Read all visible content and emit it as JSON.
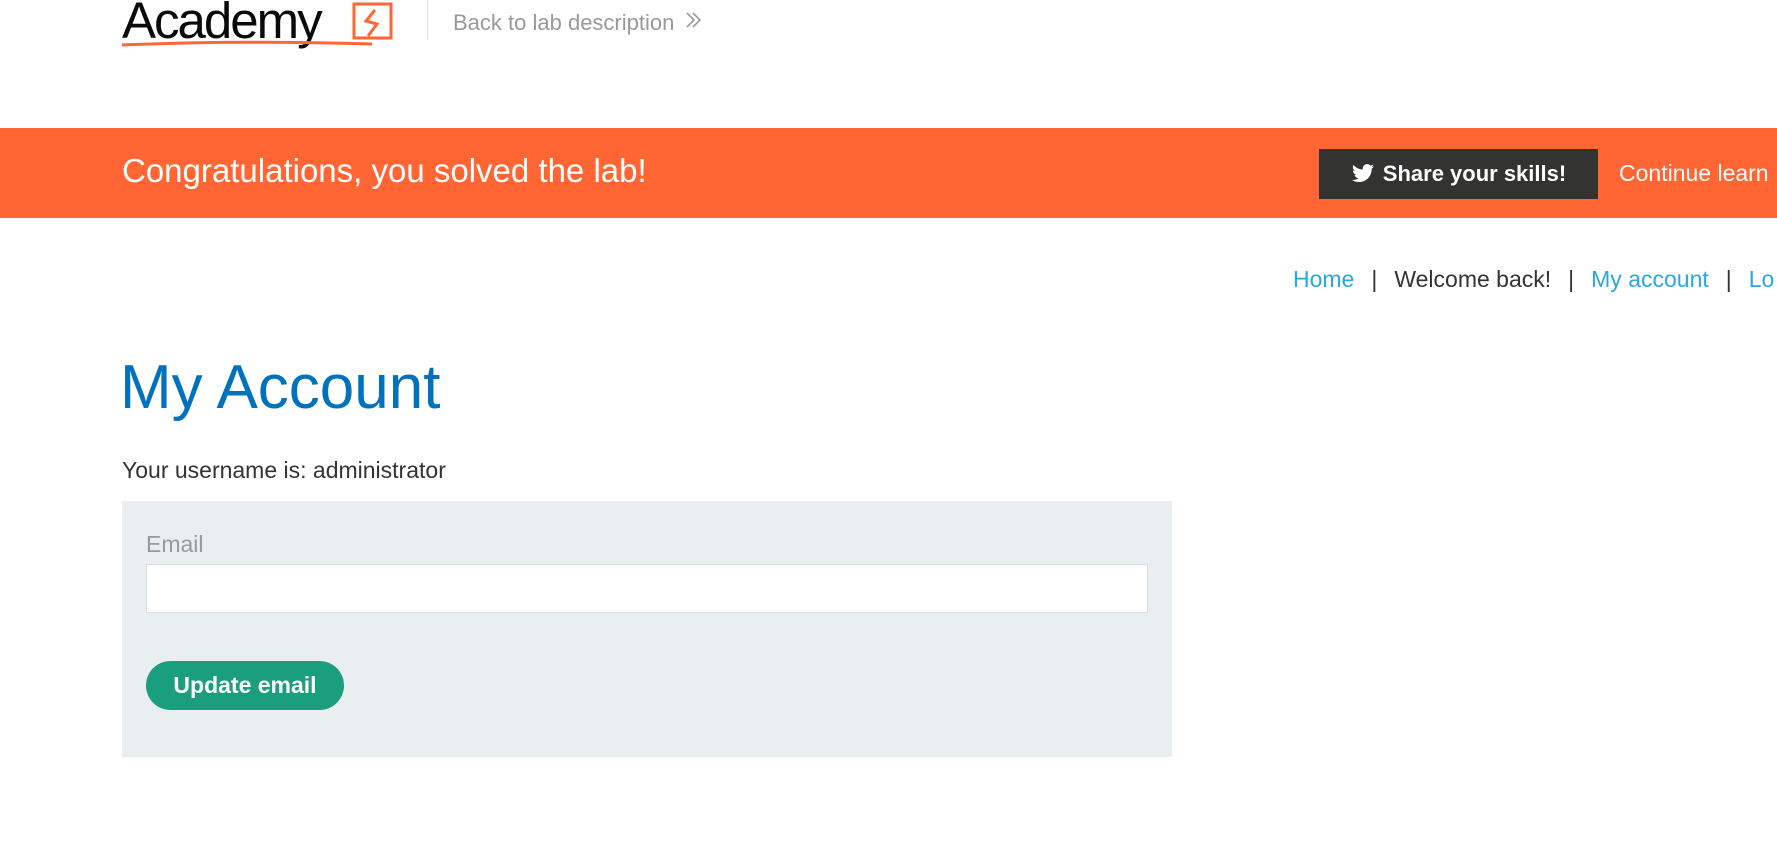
{
  "header": {
    "logo_text": "Academy",
    "back_link": "Back to lab description"
  },
  "banner": {
    "message": "Congratulations, you solved the lab!",
    "share_button": "Share your skills!",
    "continue_link": "Continue learn",
    "color": "#ff6633"
  },
  "nav": {
    "home": "Home",
    "separator": "|",
    "welcome": "Welcome back!",
    "my_account": "My account",
    "logout_partial": "Lo"
  },
  "main": {
    "title": "My Account",
    "username_line": "Your username is: administrator",
    "form": {
      "email_label": "Email",
      "email_value": "",
      "update_button": "Update email"
    }
  },
  "icons": {
    "share": "twitter-bird-icon",
    "back": "double-chevron-right-icon",
    "logo": "lightning-box-icon"
  },
  "colors": {
    "accent_orange": "#ff6633",
    "title_blue": "#0071bc",
    "link_blue": "#29a8e0",
    "button_green": "#1a9e7e",
    "dark_button": "#333332"
  }
}
